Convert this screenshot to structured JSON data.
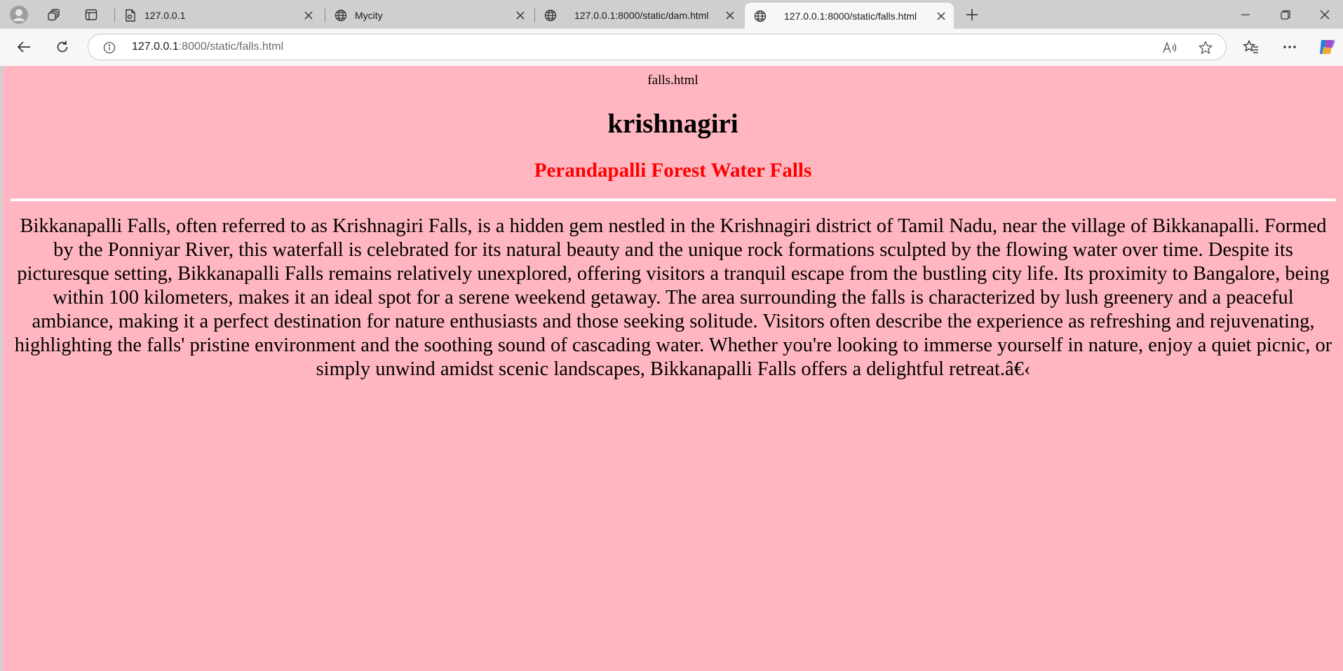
{
  "browser": {
    "tabs": [
      {
        "title": "127.0.0.1",
        "icon": "pdf-document-icon",
        "active": false
      },
      {
        "title": "Mycity",
        "icon": "globe-icon",
        "active": false
      },
      {
        "title": "127.0.0.1:8000/static/dam.html",
        "icon": "globe-icon",
        "active": false
      },
      {
        "title": "127.0.0.1:8000/static/falls.html",
        "icon": "globe-icon",
        "active": true
      }
    ],
    "address": {
      "host": "127.0.0.1",
      "rest": ":8000/static/falls.html"
    }
  },
  "page": {
    "label": "falls.html",
    "heading": "krishnagiri",
    "subheading": "Perandapalli Forest Water Falls",
    "paragraph": "Bikkanapalli Falls, often referred to as Krishnagiri Falls, is a hidden gem nestled in the Krishnagiri district of Tamil Nadu, near the village of Bikkanapalli. Formed by the Ponniyar River, this waterfall is celebrated for its natural beauty and the unique rock formations sculpted by the flowing water over time. Despite its picturesque setting, Bikkanapalli Falls remains relatively unexplored, offering visitors a tranquil escape from the bustling city life. Its proximity to Bangalore, being within 100 kilometers, makes it an ideal spot for a serene weekend getaway. The area surrounding the falls is characterized by lush greenery and a peaceful ambiance, making it a perfect destination for nature enthusiasts and those seeking solitude. Visitors often describe the experience as refreshing and rejuvenating, highlighting the falls' pristine environment and the soothing sound of cascading water. Whether you're looking to immerse yourself in nature, enjoy a quiet picnic, or simply unwind amidst scenic landscapes, Bikkanapalli Falls offers a delightful retreat.â€‹"
  },
  "colors": {
    "page_background": "#ffb6c1",
    "subheading": "#ff0000",
    "chrome": "#cfcfcf",
    "toolbar": "#f7f7f7"
  }
}
